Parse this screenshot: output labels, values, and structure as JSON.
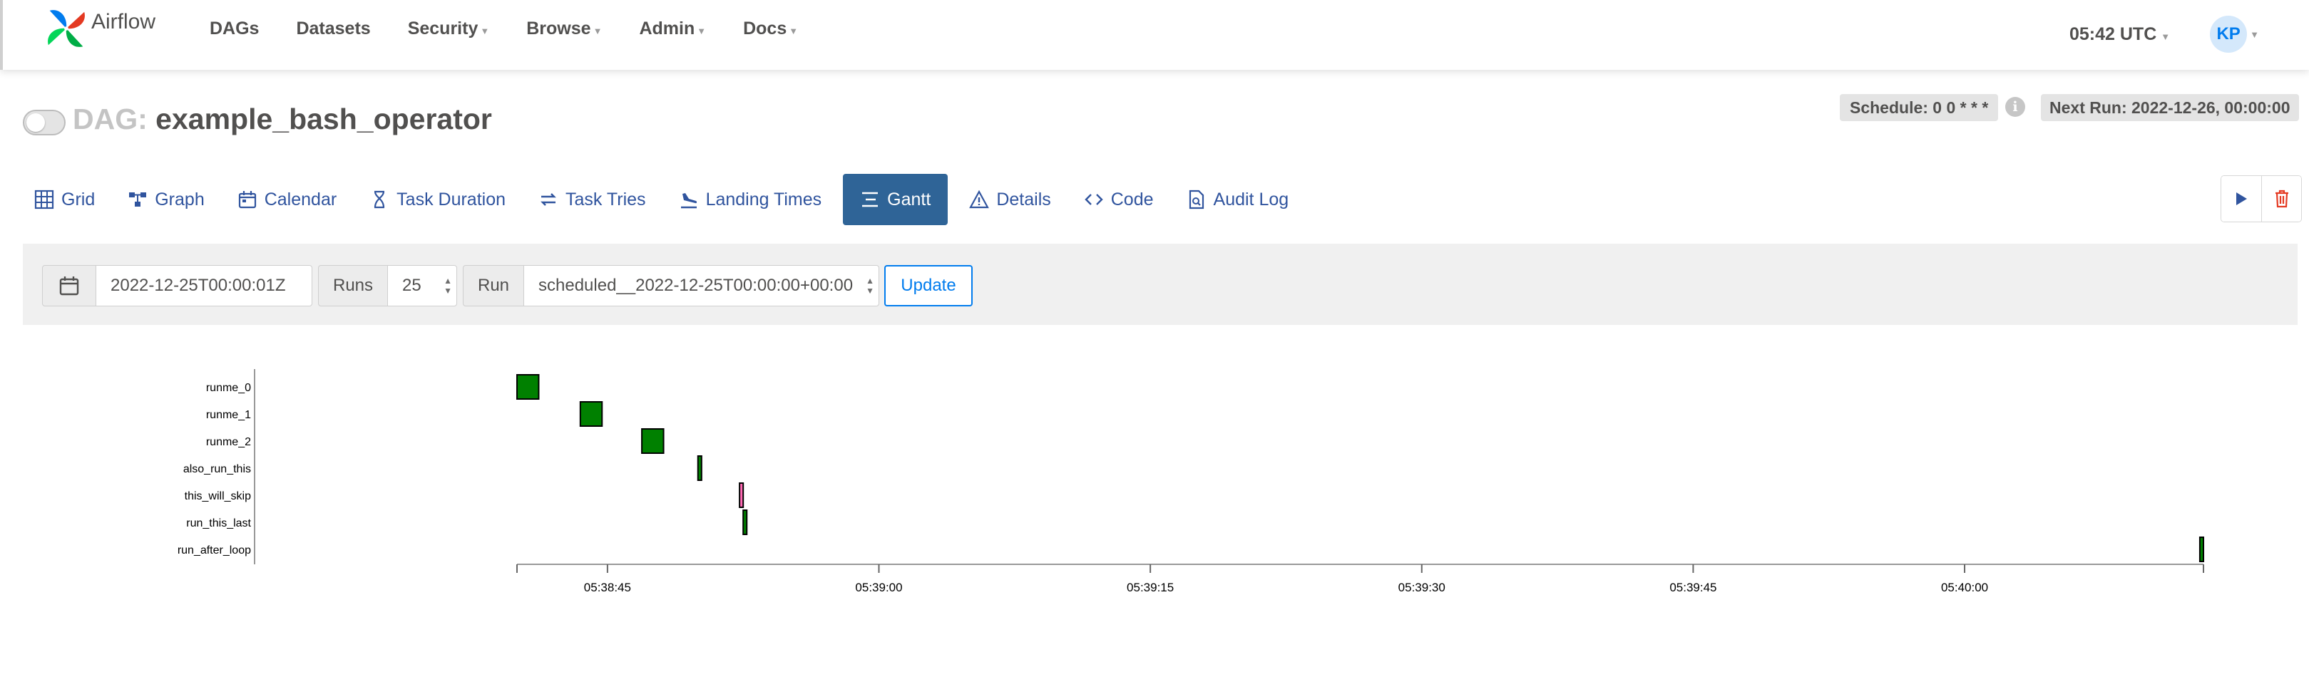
{
  "navbar": {
    "brand": "Airflow",
    "menu": [
      {
        "label": "DAGs",
        "caret": false
      },
      {
        "label": "Datasets",
        "caret": false
      },
      {
        "label": "Security",
        "caret": true
      },
      {
        "label": "Browse",
        "caret": true
      },
      {
        "label": "Admin",
        "caret": true
      },
      {
        "label": "Docs",
        "caret": true
      }
    ],
    "time": "05:42 UTC",
    "avatar": "KP"
  },
  "dag": {
    "prefix": "DAG:",
    "name": "example_bash_operator",
    "paused": true,
    "schedule": "Schedule: 0 0 * * *",
    "next_run": "Next Run: 2022-12-26, 00:00:00"
  },
  "tabs": [
    {
      "label": "Grid",
      "icon": "grid-icon",
      "active": false
    },
    {
      "label": "Graph",
      "icon": "graph-icon",
      "active": false
    },
    {
      "label": "Calendar",
      "icon": "calendar-icon",
      "active": false
    },
    {
      "label": "Task Duration",
      "icon": "hourglass-icon",
      "active": false
    },
    {
      "label": "Task Tries",
      "icon": "retry-icon",
      "active": false
    },
    {
      "label": "Landing Times",
      "icon": "landing-icon",
      "active": false
    },
    {
      "label": "Gantt",
      "icon": "gantt-icon",
      "active": true
    },
    {
      "label": "Details",
      "icon": "warning-icon",
      "active": false
    },
    {
      "label": "Code",
      "icon": "code-icon",
      "active": false
    },
    {
      "label": "Audit Log",
      "icon": "audit-log-icon",
      "active": false
    }
  ],
  "filters": {
    "date": "2022-12-25T00:00:01Z",
    "runs_label": "Runs",
    "runs_value": "25",
    "run_label": "Run",
    "run_value": "scheduled__2022-12-25T00:00:00+00:00",
    "update_label": "Update"
  },
  "colors": {
    "success": "#008000",
    "skipped": "#ff69b4",
    "active_tab": "#2f6497",
    "link": "#30549e",
    "accent": "#017cee",
    "delete": "#e43921"
  },
  "chart_data": {
    "type": "gantt",
    "tasks": [
      "runme_0",
      "runme_1",
      "runme_2",
      "also_run_this",
      "this_will_skip",
      "run_this_last",
      "run_after_loop"
    ],
    "bars": [
      {
        "task": "runme_0",
        "start": "05:38:40.0",
        "end": "05:38:41.2",
        "state": "success"
      },
      {
        "task": "runme_1",
        "start": "05:38:43.5",
        "end": "05:38:44.7",
        "state": "success"
      },
      {
        "task": "runme_2",
        "start": "05:38:46.9",
        "end": "05:38:48.1",
        "state": "success"
      },
      {
        "task": "also_run_this",
        "start": "05:38:50.0",
        "end": "05:38:50.2",
        "state": "success"
      },
      {
        "task": "this_will_skip",
        "start": "05:38:52.3",
        "end": "05:38:52.5",
        "state": "skipped"
      },
      {
        "task": "run_this_last",
        "start": "05:38:52.5",
        "end": "05:38:52.7",
        "state": "success"
      },
      {
        "task": "run_after_loop",
        "start": "05:40:13.0",
        "end": "05:40:13.2",
        "state": "success"
      }
    ],
    "x_ticks": [
      "05:38:45",
      "05:39:00",
      "05:39:15",
      "05:39:30",
      "05:39:45",
      "05:40:00"
    ],
    "xlim": [
      "05:38:40",
      "05:40:13.2"
    ]
  }
}
